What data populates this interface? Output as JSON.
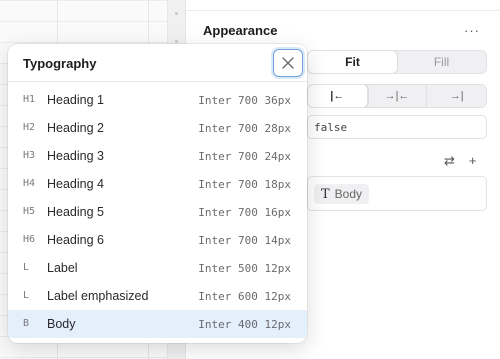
{
  "panel": {
    "title": "Appearance",
    "more_label": "···",
    "fit_label": "Fit",
    "fill_label": "Fill",
    "align_left_glyph": "|←",
    "align_center_glyph": "→|←",
    "align_right_glyph": "→|",
    "field_value": "false",
    "refresh_glyph": "⇄",
    "add_glyph": "+",
    "style_chip_glyph": "T",
    "style_chip_label": "Body"
  },
  "popover": {
    "title": "Typography",
    "items": [
      {
        "tag": "H1",
        "name": "Heading 1",
        "spec": "Inter 700 36px"
      },
      {
        "tag": "H2",
        "name": "Heading 2",
        "spec": "Inter 700 28px"
      },
      {
        "tag": "H3",
        "name": "Heading 3",
        "spec": "Inter 700 24px"
      },
      {
        "tag": "H4",
        "name": "Heading 4",
        "spec": "Inter 700 18px"
      },
      {
        "tag": "H5",
        "name": "Heading 5",
        "spec": "Inter 700 16px"
      },
      {
        "tag": "H6",
        "name": "Heading 6",
        "spec": "Inter 700 14px"
      },
      {
        "tag": "L",
        "name": "Label",
        "spec": "Inter 500 12px"
      },
      {
        "tag": "L",
        "name": "Label emphasized",
        "spec": "Inter 600 12px"
      },
      {
        "tag": "B",
        "name": "Body",
        "spec": "Inter 400 12px"
      }
    ],
    "selected_index": 8
  },
  "colors": {
    "selected_row": "#e4effc",
    "focus_ring": "#6ea3e0"
  }
}
